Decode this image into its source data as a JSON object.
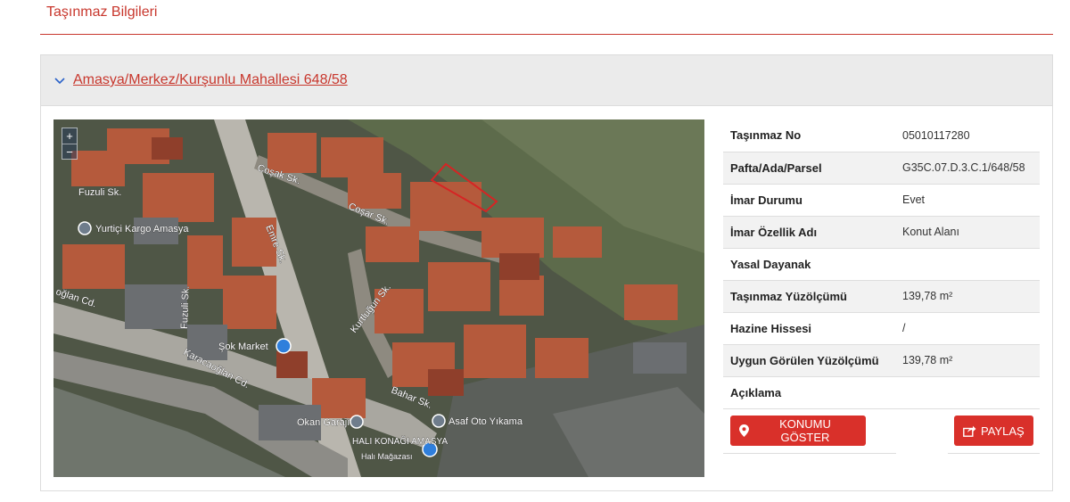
{
  "section_title": "Taşınmaz Bilgileri",
  "panel": {
    "title": "Amasya/Merkez/Kurşunlu Mahallesi 648/58",
    "colors": {
      "accent": "#c8372d",
      "button": "#d9302a"
    }
  },
  "map": {
    "zoom_in": "+",
    "zoom_out": "−",
    "labels": {
      "fuzuli1": "Fuzuli Sk.",
      "yurtici": "Yurtiçi Kargo Amasya",
      "cosak1": "Coşak Sk.",
      "cosak2": "Coşar Sk.",
      "emre": "Emre Sk.",
      "kurtlugun": "Kurtluğun Sk.",
      "oglan": "oğlan Cd.",
      "fuzuli2": "Fuzuli Sk.",
      "sok": "Şok Market",
      "karacaoglan": "Karacaoğlan Cd.",
      "bahar": "Bahar Sk.",
      "okan": "Okan Garajı",
      "asaf": "Asaf Oto Yıkama",
      "hali": "HALI KONAĞI AMASYA",
      "hali_sub": "Halı Mağazası"
    }
  },
  "info_rows": [
    {
      "label": "Taşınmaz No",
      "value": "05010117280"
    },
    {
      "label": "Pafta/Ada/Parsel",
      "value": "G35C.07.D.3.C.1/648/58"
    },
    {
      "label": "İmar Durumu",
      "value": "Evet"
    },
    {
      "label": "İmar Özellik Adı",
      "value": "Konut Alanı"
    },
    {
      "label": "Yasal Dayanak",
      "value": ""
    },
    {
      "label": "Taşınmaz Yüzölçümü",
      "value": "139,78 m²"
    },
    {
      "label": "Hazine Hissesi",
      "value": "/"
    },
    {
      "label": "Uygun Görülen Yüzölçümü",
      "value": "139,78 m²"
    },
    {
      "label": "Açıklama",
      "value": ""
    }
  ],
  "buttons": {
    "show_location": "KONUMU GÖSTER",
    "share": "PAYLAŞ"
  }
}
